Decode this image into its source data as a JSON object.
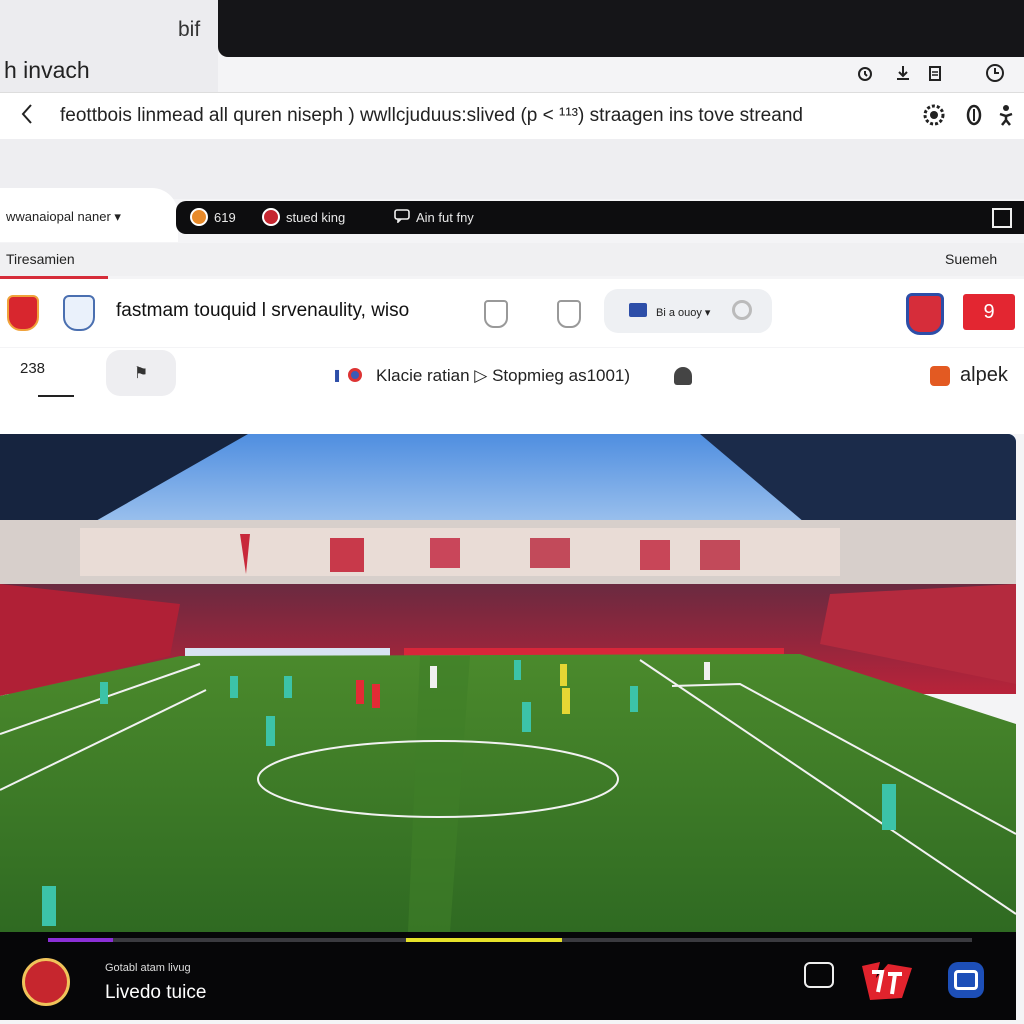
{
  "browser": {
    "tab_title": "bif",
    "window_title": "h invach",
    "url": "feottbois linmead all quren niseph  ) wwllcjuduus:slived (p <  ¹¹³) straagen ins tove streand",
    "toolbar_icons": [
      "clock-icon",
      "download-icon",
      "clipboard-icon",
      "history-icon"
    ],
    "url_icons": [
      "settings-icon",
      "shield-icon",
      "accessibility-icon"
    ]
  },
  "channel": {
    "label": "wwanaiopal naner",
    "items": [
      {
        "icon": "ball-icon",
        "label": "619"
      },
      {
        "icon": "team-crest-icon",
        "label": "stued king"
      },
      {
        "icon": "chat-icon",
        "label": "Ain fut fny"
      }
    ]
  },
  "sections": {
    "left": "Tiresamien",
    "right": "Suemeh"
  },
  "match": {
    "title": "fastmam touquid l srvenaulity, wiso",
    "quality_label": "Bi a ouoy ▾",
    "score": "9"
  },
  "controls": {
    "counter": "238",
    "status_text": "Klacie ratian ▷ Stopmieg as1001)",
    "apk_label": "alpek"
  },
  "player": {
    "small_label": "Gotabl atam livug",
    "title": "Livedo tuice",
    "progress_fraction": 0.07,
    "buffer_start_fraction": 0.387,
    "buffer_end_fraction": 0.556,
    "accent_purple": "#8b2fd6",
    "accent_yellow": "#e6e22a"
  },
  "colors": {
    "red_accent": "#d62d3a",
    "pitch_green": "#3d7a2a"
  }
}
